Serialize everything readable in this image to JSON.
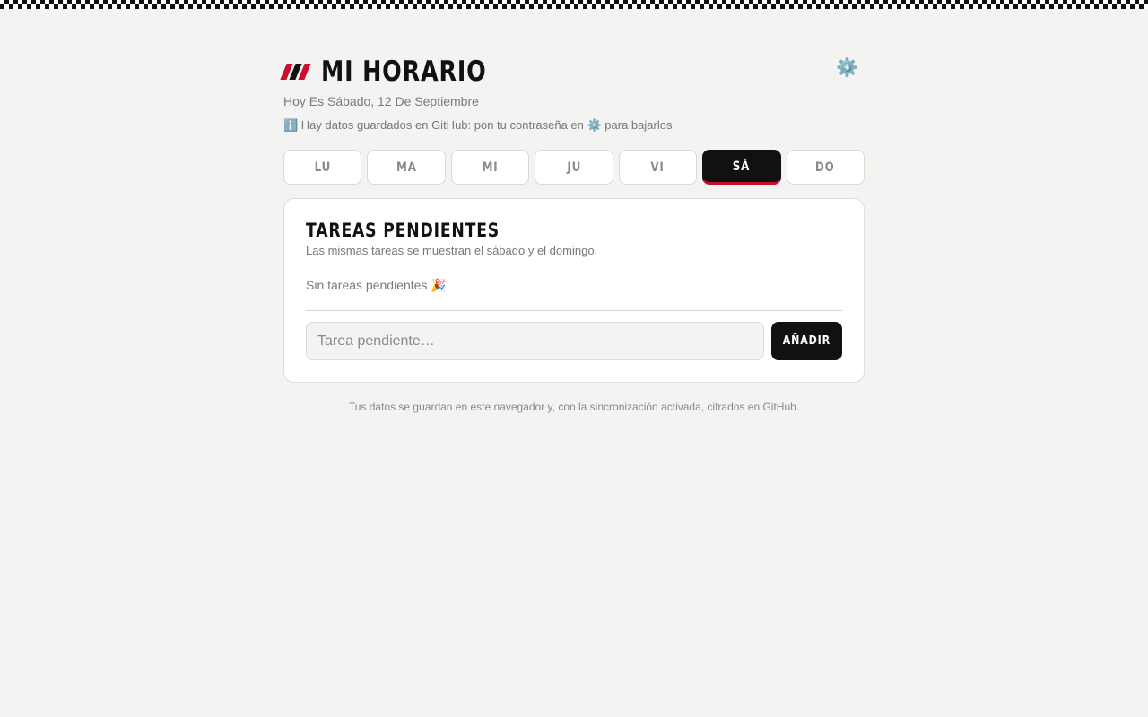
{
  "colors": {
    "accent_red": "#c8102e",
    "dark": "#111111",
    "background": "#f3f3f1",
    "gear": "#6b8ca3"
  },
  "header": {
    "title": "MI HORARIO",
    "subtitle": "Hoy Es Sábado, 12 De Septiembre",
    "notice": "ℹ️ Hay datos guardados en GitHub: pon tu contraseña en ⚙️ para bajarlos",
    "settings_icon": "gear-icon",
    "settings_glyph": "⚙️"
  },
  "days": [
    {
      "label": "LU",
      "active": false
    },
    {
      "label": "MA",
      "active": false
    },
    {
      "label": "MI",
      "active": false
    },
    {
      "label": "JU",
      "active": false
    },
    {
      "label": "VI",
      "active": false
    },
    {
      "label": "SÁ",
      "active": true
    },
    {
      "label": "DO",
      "active": false
    }
  ],
  "card": {
    "title": "TAREAS PENDIENTES",
    "subtitle": "Las mismas tareas se muestran el sábado y el domingo.",
    "empty_text": "Sin tareas pendientes 🎉",
    "input_placeholder": "Tarea pendiente…",
    "input_value": "",
    "add_label": "AÑADIR"
  },
  "footer": "Tus datos se guardan en este navegador y, con la sincronización activada, cifrados en GitHub."
}
